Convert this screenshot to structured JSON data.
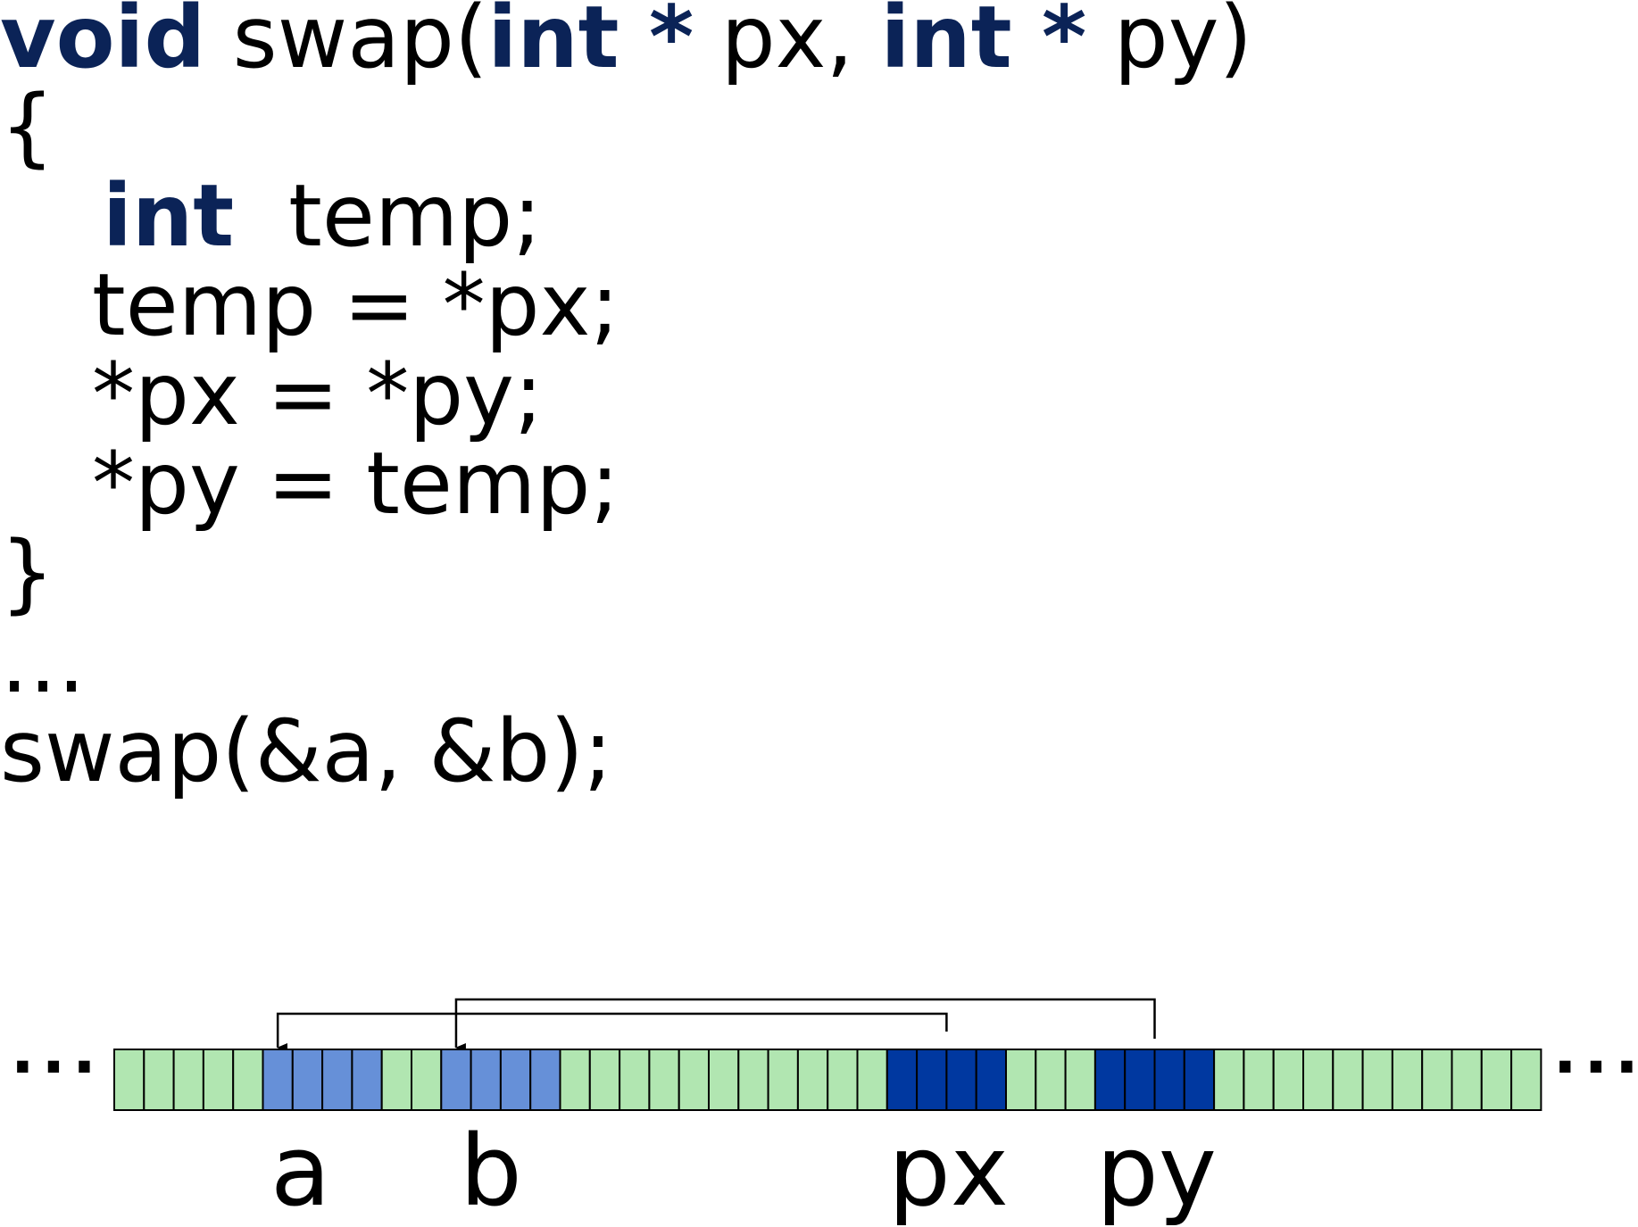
{
  "code": {
    "sig_void": "void",
    "sig_name": " swap(",
    "sig_int1": "int",
    "sig_star1": " *",
    "sig_px": " px, ",
    "sig_int2": "int",
    "sig_star2": " *",
    "sig_py": " py)",
    "open_brace": "{",
    "decl_int": "int",
    "decl_rest": "  temp;",
    "stmt1": "temp = *px;",
    "stmt2": "*px = *py;",
    "stmt3": "*py = temp;",
    "close_brace": "}",
    "ellipsis": "…",
    "call": "swap(&a, &b);"
  },
  "memory": {
    "left_dots": "···",
    "right_dots": "···",
    "label_a": "a",
    "label_b": "b",
    "label_px": "px",
    "label_py": "py",
    "cell_count": 48,
    "groups": [
      {
        "name": "a",
        "start": 5,
        "length": 4,
        "role": "variable"
      },
      {
        "name": "b",
        "start": 11,
        "length": 4,
        "role": "variable"
      },
      {
        "name": "px",
        "start": 26,
        "length": 4,
        "role": "pointer",
        "points_to": "a"
      },
      {
        "name": "py",
        "start": 33,
        "length": 4,
        "role": "pointer",
        "points_to": "b"
      }
    ]
  },
  "colors": {
    "keyword": "#0b2357",
    "cell_default": "#b1e6b1",
    "cell_variable": "#6690d8",
    "cell_pointer": "#0038a0",
    "cell_border": "#000000"
  }
}
